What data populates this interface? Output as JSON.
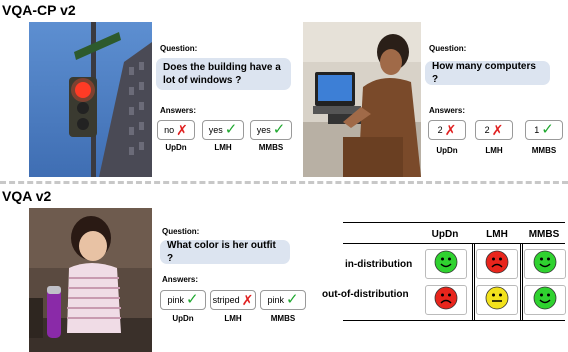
{
  "sections": [
    {
      "title": "VQA-CP v2"
    },
    {
      "title": "VQA v2"
    }
  ],
  "labels": {
    "question": "Question:",
    "answers": "Answers:"
  },
  "examples": [
    {
      "question": "Does the building have a lot of windows ?",
      "answers": [
        {
          "text": "no",
          "mark": "✗",
          "model": "UpDn"
        },
        {
          "text": "yes",
          "mark": "✓",
          "model": "LMH"
        },
        {
          "text": "yes",
          "mark": "✓",
          "model": "MMBS"
        }
      ]
    },
    {
      "question": "How many computers ?",
      "answers": [
        {
          "text": "2",
          "mark": "✗",
          "model": "UpDn"
        },
        {
          "text": "2",
          "mark": "✗",
          "model": "LMH"
        },
        {
          "text": "1",
          "mark": "✓",
          "model": "MMBS"
        }
      ]
    },
    {
      "question": "What color is her outfit ?",
      "answers": [
        {
          "text": "pink",
          "mark": "✓",
          "model": "UpDn"
        },
        {
          "text": "striped",
          "mark": "✗",
          "model": "LMH"
        },
        {
          "text": "pink",
          "mark": "✓",
          "model": "MMBS"
        }
      ]
    }
  ],
  "table": {
    "columns": [
      "UpDn",
      "LMH",
      "MMBS"
    ],
    "rows": [
      {
        "label": "in-distribution",
        "faces": [
          "happy",
          "sad",
          "happy"
        ]
      },
      {
        "label": "out-of-distribution",
        "faces": [
          "sad",
          "neutral",
          "happy"
        ]
      }
    ]
  },
  "colors": {
    "happy": "#2fd22f",
    "sad": "#e8251c",
    "neutral": "#f2e21c",
    "bubble": "#dce4f0"
  }
}
